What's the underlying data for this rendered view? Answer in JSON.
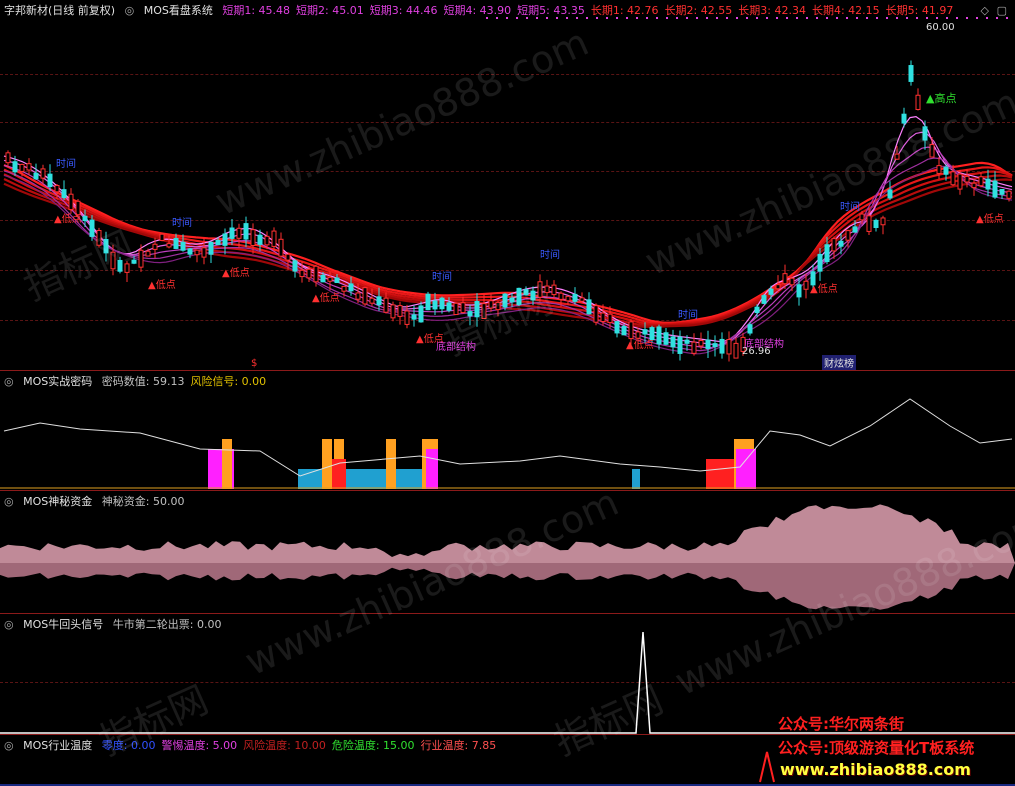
{
  "main_pane": {
    "title": "字邦新材(日线 前复权)",
    "indicator": "MOS看盘系统",
    "values": [
      {
        "label": "短期1: 45.48",
        "color": "#e040e0"
      },
      {
        "label": "短期2: 45.01",
        "color": "#e040e0"
      },
      {
        "label": "短期3: 44.46",
        "color": "#e040e0"
      },
      {
        "label": "短期4: 43.90",
        "color": "#e040e0"
      },
      {
        "label": "短期5: 43.35",
        "color": "#e040e0"
      },
      {
        "label": "长期1: 42.76",
        "color": "#ff3030"
      },
      {
        "label": "长期2: 42.55",
        "color": "#ff3030"
      },
      {
        "label": "长期3: 42.34",
        "color": "#ff3030"
      },
      {
        "label": "长期4: 42.15",
        "color": "#ff3030"
      },
      {
        "label": "长期5: 41.97",
        "color": "#ff3030"
      }
    ],
    "high_price": "60.00",
    "low_price": "26.96",
    "labels": {
      "gaodian": "▲高点",
      "didian": "▲低点",
      "shijian": "时间",
      "dibu": "底部结构",
      "caifu": "财炫榜",
      "marker_s": "$"
    }
  },
  "pane2": {
    "indicator": "MOS实战密码",
    "values": [
      {
        "label": "密码数值: 59.13",
        "color": "#c0c0c0"
      },
      {
        "label": "风险信号: 0.00",
        "color": "#e0c000"
      }
    ]
  },
  "pane3": {
    "indicator": "MOS神秘资金",
    "values": [
      {
        "label": "神秘资金: 50.00",
        "color": "#c0c0c0"
      }
    ]
  },
  "pane4": {
    "indicator": "MOS牛回头信号",
    "values": [
      {
        "label": "牛市第二轮出票: 0.00",
        "color": "#c0c0c0"
      }
    ]
  },
  "pane5": {
    "indicator": "MOS行业温度",
    "values": [
      {
        "label": "零度: 0.00",
        "color": "#3050ff"
      },
      {
        "label": "警惕温度: 5.00",
        "color": "#e040e0"
      },
      {
        "label": "风险温度: 10.00",
        "color": "#c02020"
      },
      {
        "label": "危险温度: 15.00",
        "color": "#30e030"
      },
      {
        "label": "行业温度: 7.85",
        "color": "#ff5050"
      }
    ]
  },
  "promo": {
    "line1": "公众号:华尔两条街",
    "line2": "公众号:顶级游资量化T板系统",
    "line3": "www.zhibiao888.com"
  },
  "watermarks": {
    "site": "www.zhibiao888.com",
    "brand": "指标网"
  },
  "chart_data": [
    {
      "type": "candlestick",
      "title": "字邦新材(日线 前复权)",
      "annotations": [
        "60.00",
        "26.96",
        "▲高点",
        "▲低点",
        "时间",
        "底部结构"
      ],
      "series": [
        {
          "name": "短期1",
          "last": 45.48
        },
        {
          "name": "短期2",
          "last": 45.01
        },
        {
          "name": "短期3",
          "last": 44.46
        },
        {
          "name": "短期4",
          "last": 43.9
        },
        {
          "name": "短期5",
          "last": 43.35
        },
        {
          "name": "长期1",
          "last": 42.76
        },
        {
          "name": "长期2",
          "last": 42.55
        },
        {
          "name": "长期3",
          "last": 42.34
        },
        {
          "name": "长期4",
          "last": 42.15
        },
        {
          "name": "长期5",
          "last": 41.97
        }
      ]
    },
    {
      "type": "line",
      "title": "MOS实战密码",
      "series": [
        {
          "name": "密码数值",
          "last": 59.13
        },
        {
          "name": "风险信号",
          "last": 0.0
        }
      ]
    },
    {
      "type": "area",
      "title": "MOS神秘资金",
      "series": [
        {
          "name": "神秘资金",
          "last": 50.0
        }
      ]
    },
    {
      "type": "line",
      "title": "MOS牛回头信号",
      "series": [
        {
          "name": "牛市第二轮出票",
          "last": 0.0
        }
      ]
    },
    {
      "type": "line",
      "title": "MOS行业温度",
      "series": [
        {
          "name": "零度",
          "last": 0.0
        },
        {
          "name": "警惕温度",
          "last": 5.0
        },
        {
          "name": "风险温度",
          "last": 10.0
        },
        {
          "name": "危险温度",
          "last": 15.0
        },
        {
          "name": "行业温度",
          "last": 7.85
        }
      ]
    }
  ]
}
